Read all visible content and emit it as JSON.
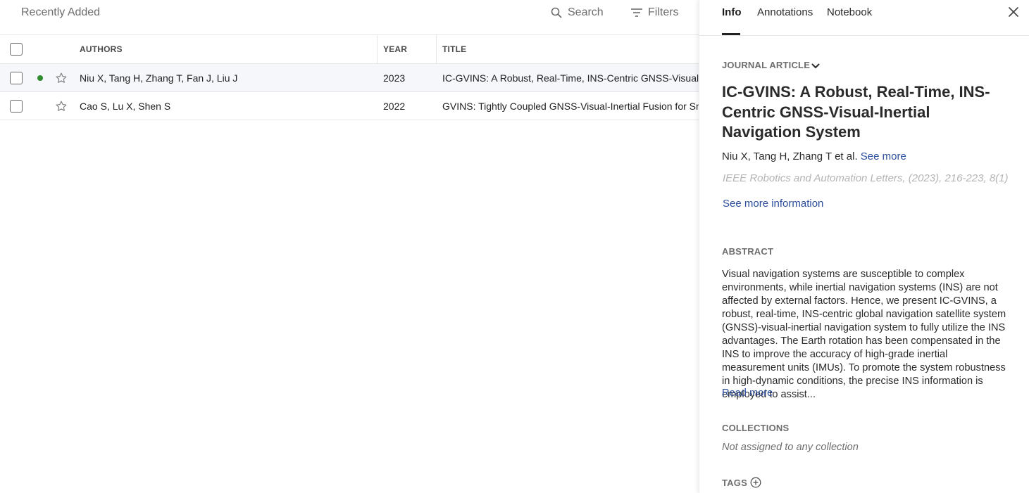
{
  "header": {
    "view_title": "Recently Added",
    "search_label": "Search",
    "filters_label": "Filters"
  },
  "table": {
    "columns": {
      "authors": "AUTHORS",
      "year": "YEAR",
      "title": "TITLE"
    },
    "rows": [
      {
        "authors": "Niu X, Tang H, Zhang T, Fan J, Liu J",
        "year": "2023",
        "title": "IC-GVINS: A Robust, Real-Time, INS-Centric GNSS-Visual-Inertial Navigation System",
        "unread": true,
        "selected": true
      },
      {
        "authors": "Cao S, Lu X, Shen S",
        "year": "2022",
        "title": "GVINS: Tightly Coupled GNSS-Visual-Inertial Fusion for Smooth and Consistent State Estimation",
        "unread": false,
        "selected": false
      }
    ]
  },
  "detail": {
    "tabs": [
      "Info",
      "Annotations",
      "Notebook"
    ],
    "active_tab": "Info",
    "doc_type": "JOURNAL ARTICLE",
    "title": "IC-GVINS: A Robust, Real-Time, INS-Centric GNSS-Visual-Inertial Navigation System",
    "authors": "Niu X, Tang H, Zhang T et al.",
    "see_more": "See more",
    "journal": "IEEE Robotics and Automation Letters, (2023), 216-223, 8(1)",
    "see_more_information": "See more information",
    "abstract_label": "ABSTRACT",
    "abstract": "Visual navigation systems are susceptible to complex environments, while inertial navigation systems (INS) are not affected by external factors. Hence, we present IC-GVINS, a robust, real-time, INS-centric global navigation satellite system (GNSS)-visual-inertial navigation system to fully utilize the INS advantages. The Earth rotation has been compensated in the INS to improve the accuracy of high-grade inertial measurement units (IMUs). To promote the system robustness in high-dynamic conditions, the precise INS information is employed to assist...",
    "read_more": "Read more",
    "collections_label": "COLLECTIONS",
    "collections_empty": "Not assigned to any collection",
    "tags_label": "TAGS"
  },
  "colors": {
    "link": "#2b4e9e",
    "unread_dot": "#2e8b2e",
    "selected_row": "#f5f7fb"
  }
}
